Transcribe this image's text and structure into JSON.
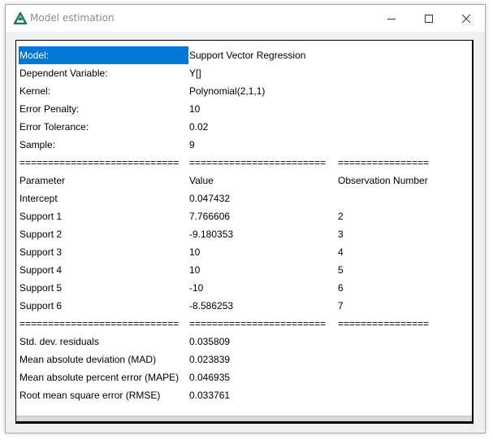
{
  "window": {
    "title": "Model estimation",
    "colors": {
      "selection": "#0078d7",
      "icon": "#1f7a4d"
    }
  },
  "table": {
    "rows": [
      [
        "Model:",
        "Support Vector Regression",
        ""
      ],
      [
        "Dependent Variable:",
        "Y[]",
        ""
      ],
      [
        "Kernel:",
        "Polynomial(2,1,1)",
        ""
      ],
      [
        "Error Penalty:",
        "10",
        ""
      ],
      [
        "Error Tolerance:",
        "0.02",
        ""
      ],
      [
        "Sample:",
        "9",
        ""
      ],
      [
        "============================",
        "========================",
        "================"
      ],
      [
        "Parameter",
        "Value",
        "Observation Number"
      ],
      [
        "Intercept",
        "0.047432",
        ""
      ],
      [
        "Support 1",
        "7.766606",
        "2"
      ],
      [
        "Support 2",
        "-9.180353",
        "3"
      ],
      [
        "Support 3",
        "10",
        "4"
      ],
      [
        "Support 4",
        "10",
        "5"
      ],
      [
        "Support 5",
        "-10",
        "6"
      ],
      [
        "Support 6",
        "-8.586253",
        "7"
      ],
      [
        "============================",
        "========================",
        "================"
      ],
      [
        "Std. dev. residuals",
        "0.035809",
        ""
      ],
      [
        "Mean absolute deviation (MAD)",
        "0.023839",
        ""
      ],
      [
        "Mean absolute percent error (MAPE)",
        "0.046935",
        ""
      ],
      [
        "Root mean square error (RMSE)",
        "0.033761",
        ""
      ]
    ]
  }
}
